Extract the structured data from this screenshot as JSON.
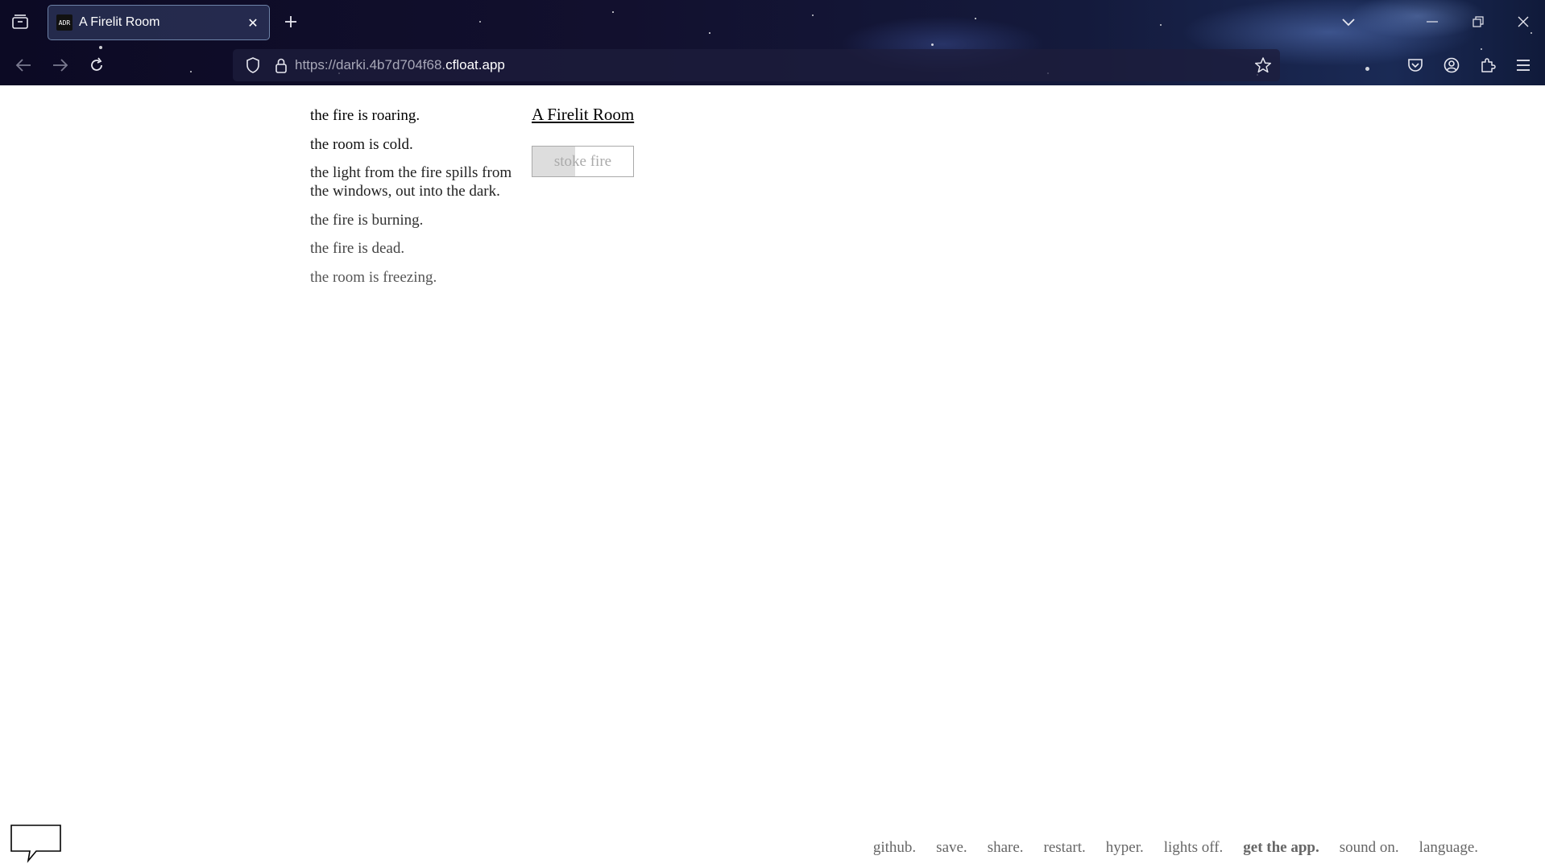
{
  "browser": {
    "tab": {
      "favicon_text": "ADR",
      "title": "A Firelit Room"
    },
    "url": {
      "prefix": "https://darki.4b7d704f68.",
      "domain": "cfloat.app"
    }
  },
  "notifications": [
    {
      "text": "the fire is roaring.",
      "color": "#000000"
    },
    {
      "text": "the room is cold.",
      "color": "#111111"
    },
    {
      "text": "the light from the fire spills from the windows, out into the dark.",
      "color": "#222222"
    },
    {
      "text": "the fire is burning.",
      "color": "#333333"
    },
    {
      "text": "the fire is dead.",
      "color": "#444444"
    },
    {
      "text": "the room is freezing.",
      "color": "#555555"
    }
  ],
  "location": {
    "title": "A Firelit Room"
  },
  "actions": {
    "stoke_fire": {
      "label": "stoke fire",
      "cooldown_progress": 0.42
    }
  },
  "footer": {
    "github": "github.",
    "save": "save.",
    "share": "share.",
    "restart": "restart.",
    "hyper": "hyper.",
    "lights": "lights off.",
    "get_app": "get the app.",
    "sound": "sound on.",
    "language": "language."
  }
}
